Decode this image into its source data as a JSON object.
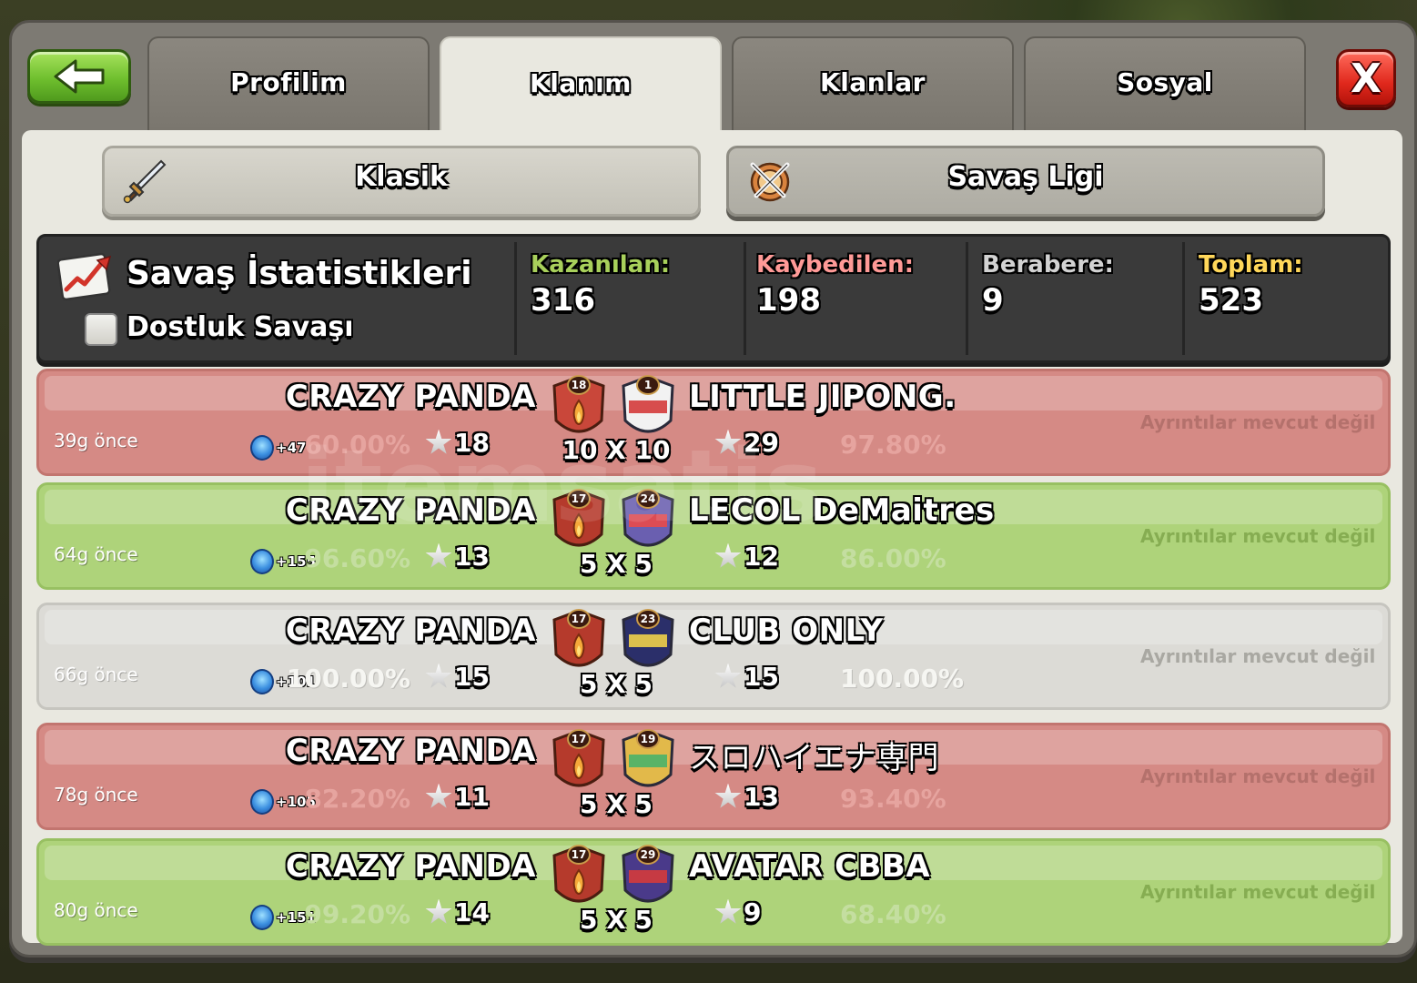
{
  "nav": {
    "tabs": [
      {
        "label": "Profilim"
      },
      {
        "label": "Klanım"
      },
      {
        "label": "Klanlar"
      },
      {
        "label": "Sosyal"
      }
    ],
    "close_label": "X"
  },
  "subtabs": {
    "classic": "Klasik",
    "league": "Savaş Ligi"
  },
  "stats": {
    "title": "Savaş İstatistikleri",
    "friendly_label": "Dostluk Savaşı",
    "won_label": "Kazanılan:",
    "won": "316",
    "lost_label": "Kaybedilen:",
    "lost": "198",
    "draw_label": "Berabere:",
    "draw": "9",
    "total_label": "Toplam:",
    "total": "523"
  },
  "colors": {
    "won": "#a8d05b",
    "lost": "#ff9a97",
    "draw": "#d2d2d2",
    "total": "#ffd75a",
    "row_loss": "#d58a85",
    "row_win": "#aed37a",
    "row_draw": "#dcdbd6"
  },
  "wars": [
    {
      "result": "loss",
      "ago": "39g önce",
      "clan": "CRAZY PANDA",
      "clan_level": "18",
      "xp": "+47",
      "percent": "60.00%",
      "stars": "18",
      "size": "10 X 10",
      "opponent": "LITTLE JIPONG.",
      "opponent_level": "1",
      "opponent_stars": "29",
      "opponent_percent": "97.80%",
      "details": "Ayrıntılar mevcut değil"
    },
    {
      "result": "win",
      "ago": "64g önce",
      "clan": "CRAZY PANDA",
      "clan_level": "17",
      "xp": "+155",
      "percent": "96.60%",
      "stars": "13",
      "size": "5 X 5",
      "opponent": "LECOL DeMaitres",
      "opponent_level": "24",
      "opponent_stars": "12",
      "opponent_percent": "86.00%",
      "details": "Ayrıntılar mevcut değil"
    },
    {
      "result": "draw",
      "ago": "66g önce",
      "clan": "CRAZY PANDA",
      "clan_level": "17",
      "xp": "+101",
      "percent": "100.00%",
      "stars": "15",
      "size": "5 X 5",
      "opponent": "CLUB ONLY",
      "opponent_level": "23",
      "opponent_stars": "15",
      "opponent_percent": "100.00%",
      "details": "Ayrıntılar mevcut değil"
    },
    {
      "result": "loss",
      "ago": "78g önce",
      "clan": "CRAZY PANDA",
      "clan_level": "17",
      "xp": "+105",
      "percent": "82.20%",
      "stars": "11",
      "size": "5 X 5",
      "opponent": "スロハイエナ専門",
      "opponent_level": "19",
      "opponent_stars": "13",
      "opponent_percent": "93.40%",
      "details": "Ayrıntılar mevcut değil"
    },
    {
      "result": "win",
      "ago": "80g önce",
      "clan": "CRAZY PANDA",
      "clan_level": "17",
      "xp": "+151",
      "percent": "99.20%",
      "stars": "14",
      "size": "5 X 5",
      "opponent": "AVATAR CBBA",
      "opponent_level": "29",
      "opponent_stars": "9",
      "opponent_percent": "68.40%",
      "details": "Ayrıntılar mevcut değil"
    }
  ],
  "watermark": "itemsatis"
}
